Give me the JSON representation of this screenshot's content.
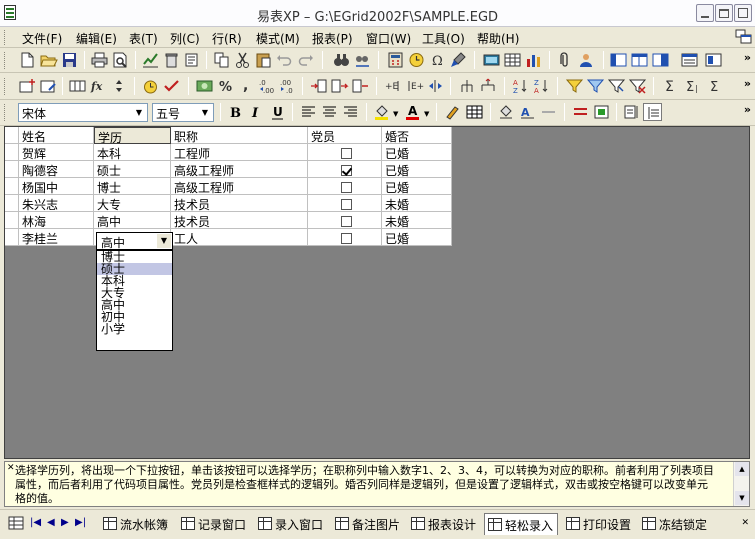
{
  "window": {
    "title": "易表XP  –  G:\\EGrid2002F\\SAMPLE.EGD"
  },
  "menu": [
    {
      "id": "file",
      "label": "文件(F)"
    },
    {
      "id": "edit",
      "label": "编辑(E)"
    },
    {
      "id": "table",
      "label": "表(T)"
    },
    {
      "id": "column",
      "label": "列(C)"
    },
    {
      "id": "row",
      "label": "行(R)"
    },
    {
      "id": "mode",
      "label": "模式(M)"
    },
    {
      "id": "report",
      "label": "报表(P)"
    },
    {
      "id": "window",
      "label": "窗口(W)"
    },
    {
      "id": "tools",
      "label": "工具(O)"
    },
    {
      "id": "help",
      "label": "帮助(H)"
    }
  ],
  "format_bar": {
    "font_name": "宋体",
    "font_size": "五号"
  },
  "grid": {
    "columns": [
      "姓名",
      "学历",
      "职称",
      "党员",
      "婚否"
    ],
    "rows": [
      {
        "name": "贺辉",
        "edu": "本科",
        "title": "工程师",
        "party": false,
        "married": "已婚"
      },
      {
        "name": "陶德容",
        "edu": "硕士",
        "title": "高级工程师",
        "party": true,
        "married": "已婚"
      },
      {
        "name": "杨国中",
        "edu": "博士",
        "title": "高级工程师",
        "party": false,
        "married": "已婚"
      },
      {
        "name": "朱兴志",
        "edu": "大专",
        "title": "技术员",
        "party": false,
        "married": "未婚"
      },
      {
        "name": "林海",
        "edu": "高中",
        "title": "技术员",
        "party": false,
        "married": "未婚"
      },
      {
        "name": "李桂兰",
        "edu": "高中",
        "title": "工人",
        "party": false,
        "married": "已婚"
      }
    ],
    "editor_value": "高中",
    "dropdown_options": [
      "博士",
      "硕士",
      "本科",
      "大专",
      "高中",
      "初中",
      "小学"
    ],
    "dropdown_selected": "硕士"
  },
  "info_text": "选择学历列，将出现一个下拉按钮，单击该按钮可以选择学历；在职称列中输入数字1、2、3、4，可以转换为对应的职称。前者利用了列表项目属性，而后者利用了代码项目属性。党员列是检查框样式的逻辑列。婚否列同样是逻辑列，但是设置了逻辑样式，双击或按空格键可以改变单元格的值。",
  "tabs": [
    {
      "id": "ledger",
      "label": "流水帐簿"
    },
    {
      "id": "record",
      "label": "记录窗口"
    },
    {
      "id": "entry",
      "label": "录入窗口"
    },
    {
      "id": "notes",
      "label": "备注图片"
    },
    {
      "id": "report",
      "label": "报表设计"
    },
    {
      "id": "easy",
      "label": "轻松录入",
      "active": true
    },
    {
      "id": "print",
      "label": "打印设置"
    },
    {
      "id": "freeze",
      "label": "冻结锁定"
    }
  ],
  "colors": {
    "grid_bg": "#808080",
    "info_bg": "#ffffe1",
    "selected_option": "#c2c6e4",
    "toolbar_bg": "#ece9d8"
  }
}
